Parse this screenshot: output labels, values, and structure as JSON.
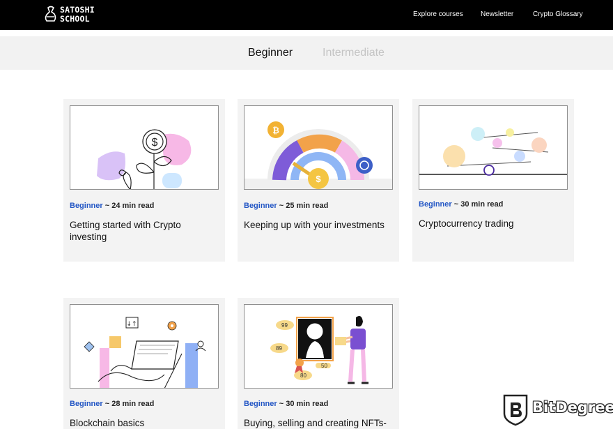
{
  "header": {
    "logo_line1": "SATOSHI",
    "logo_line2": "SCHOOL",
    "nav": [
      "Explore courses",
      "Newsletter",
      "Crypto Glossary"
    ]
  },
  "tabs": [
    {
      "label": "Beginner",
      "active": true
    },
    {
      "label": "Intermediate",
      "active": false
    }
  ],
  "cards": [
    {
      "level": "Beginner",
      "read_time": "~ 24 min read",
      "title": "Getting started with Crypto investing",
      "image_icon": "dollar-plant-icon"
    },
    {
      "level": "Beginner",
      "read_time": "~ 25 min read",
      "title": "Keeping up with your investments",
      "image_icon": "crypto-gauge-icon"
    },
    {
      "level": "Beginner",
      "read_time": "~ 30 min read",
      "title": "Cryptocurrency trading",
      "image_icon": "balancing-scales-icon"
    },
    {
      "level": "Beginner",
      "read_time": "~ 28 min read",
      "title": "Blockchain basics",
      "image_icon": "blockchain-blocks-icon"
    },
    {
      "level": "Beginner",
      "read_time": "~ 30 min read",
      "title": "Buying, selling and creating NFTs-",
      "image_icon": "nft-art-icon"
    }
  ],
  "eth_prices": [
    "99",
    "89",
    "80",
    "50"
  ],
  "watermark": {
    "text": "BitDegree"
  },
  "colors": {
    "accent": "#2457c5",
    "topbar": "#000000",
    "tabsbar": "#f2f2f2",
    "card_bg": "#f3f3f3"
  }
}
